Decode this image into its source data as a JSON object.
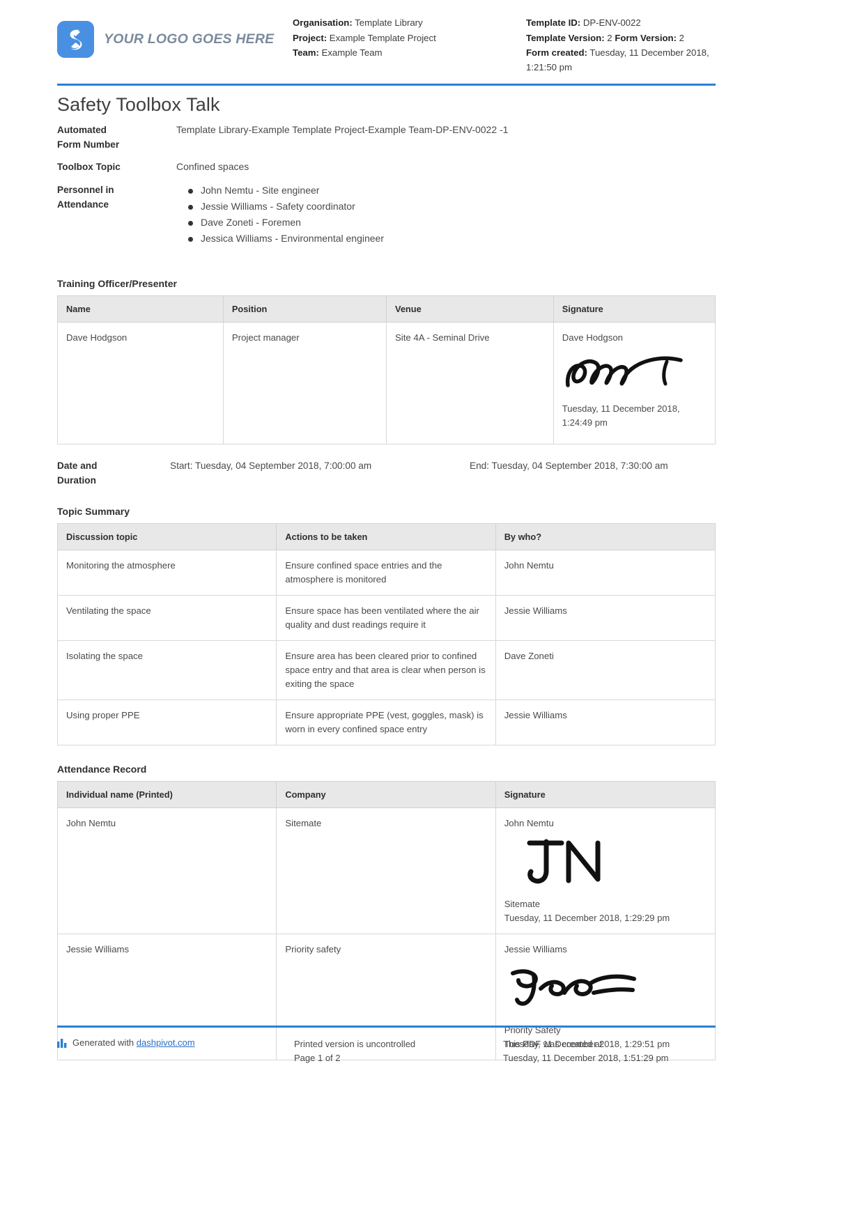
{
  "header": {
    "logo_text": "YOUR LOGO GOES HERE",
    "logo_icon": "s-mark-logo-icon",
    "organisation_label": "Organisation:",
    "organisation_value": "Template Library",
    "project_label": "Project:",
    "project_value": "Example Template Project",
    "team_label": "Team:",
    "team_value": "Example Team",
    "template_id_label": "Template ID:",
    "template_id_value": "DP-ENV-0022",
    "template_version_label": "Template Version:",
    "template_version_value": "2",
    "form_version_label": "Form Version:",
    "form_version_value": "2",
    "form_created_label": "Form created:",
    "form_created_value": "Tuesday, 11 December 2018,",
    "form_created_value2": "1:21:50 pm"
  },
  "title": "Safety Toolbox Talk",
  "fields": {
    "form_number_label_l1": "Automated",
    "form_number_label_l2": "Form Number",
    "form_number_value": "Template Library-Example Template Project-Example Team-DP-ENV-0022   -1",
    "toolbox_topic_label": "Toolbox Topic",
    "toolbox_topic_value": "Confined spaces",
    "personnel_label_l1": "Personnel in",
    "personnel_label_l2": "Attendance",
    "personnel": [
      "John Nemtu - Site engineer",
      "Jessie Williams - Safety coordinator",
      "Dave Zoneti - Foremen",
      "Jessica Williams - Environmental engineer"
    ]
  },
  "training_officer": {
    "section_title": "Training Officer/Presenter",
    "columns": [
      "Name",
      "Position",
      "Venue",
      "Signature"
    ],
    "rows": [
      {
        "name": "Dave Hodgson",
        "position": "Project manager",
        "venue": "Site 4A - Seminal Drive",
        "signature_name": "Dave Hodgson",
        "signature_date": "Tuesday, 11 December 2018,",
        "signature_time": "1:24:49 pm"
      }
    ]
  },
  "duration": {
    "label_l1": "Date and",
    "label_l2": "Duration",
    "start": "Start: Tuesday, 04 September 2018, 7:00:00 am",
    "end": "End: Tuesday, 04 September 2018, 7:30:00 am"
  },
  "topic_summary": {
    "section_title": "Topic Summary",
    "columns": [
      "Discussion topic",
      "Actions to be taken",
      "By who?"
    ],
    "rows": [
      {
        "topic": "Monitoring the atmosphere",
        "action": "Ensure confined space entries and the atmosphere is monitored",
        "by_who": "John Nemtu"
      },
      {
        "topic": "Ventilating the space",
        "action": "Ensure space has been ventilated where the air quality and dust readings require it",
        "by_who": "Jessie Williams"
      },
      {
        "topic": "Isolating the space",
        "action": "Ensure area has been cleared prior to confined space entry and that area is clear when person is exiting the space",
        "by_who": "Dave Zoneti"
      },
      {
        "topic": "Using proper PPE",
        "action": "Ensure appropriate PPE (vest, goggles, mask) is worn in every confined space entry",
        "by_who": "Jessie Williams"
      }
    ]
  },
  "attendance_record": {
    "section_title": "Attendance Record",
    "columns": [
      "Individual name (Printed)",
      "Company",
      "Signature"
    ],
    "rows": [
      {
        "name": "John Nemtu",
        "company": "Sitemate",
        "signature_name": "John Nemtu",
        "signature_glyph": "JN",
        "signature_company": "Sitemate",
        "signature_datetime": "Tuesday, 11 December 2018, 1:29:29 pm"
      },
      {
        "name": "Jessie Williams",
        "company": "Priority safety",
        "signature_name": "Jessie Williams",
        "signature_glyph": "Jess",
        "signature_company": "Priority Safety",
        "signature_datetime": "Tuesday, 11 December 2018, 1:29:51 pm"
      }
    ]
  },
  "footer": {
    "generated_prefix": "Generated with ",
    "generated_link": "dashpivot.com",
    "uncontrolled": "Printed version is uncontrolled",
    "page_number": "Page 1 of 2",
    "created_at_label": "This PDF was created at",
    "created_at_value": "Tuesday, 11 December 2018, 1:51:29 pm"
  },
  "colors": {
    "accent_blue": "#2b7fd4",
    "logo_blue": "#4a90e2",
    "header_grey": "#e8e8e8",
    "link_blue": "#2b6fc4"
  }
}
